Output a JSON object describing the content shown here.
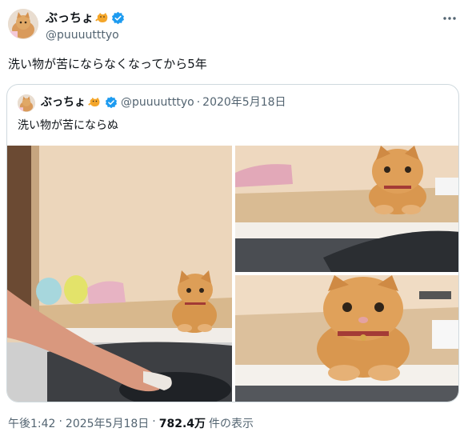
{
  "post": {
    "author_name": "ぶっちょ",
    "author_handle": "@puuuutttyo",
    "text": "洗い物が苦にならなくなってから5年",
    "more_icon": "more-horizontal-icon"
  },
  "quoted": {
    "author_name": "ぶっちょ",
    "author_handle": "@puuuutttyo",
    "separator": "·",
    "date": "2020年5月18日",
    "text": "洗い物が苦にならぬ"
  },
  "footer": {
    "time": "午後1:42",
    "sep": "·",
    "date": "2025年5月18日",
    "sep2": "·",
    "views": "782.4万",
    "views_label": "件の表示"
  },
  "colors": {
    "verified_blue": "#1d9bf0",
    "secondary_text": "#536471",
    "border": "#cfd9de"
  }
}
